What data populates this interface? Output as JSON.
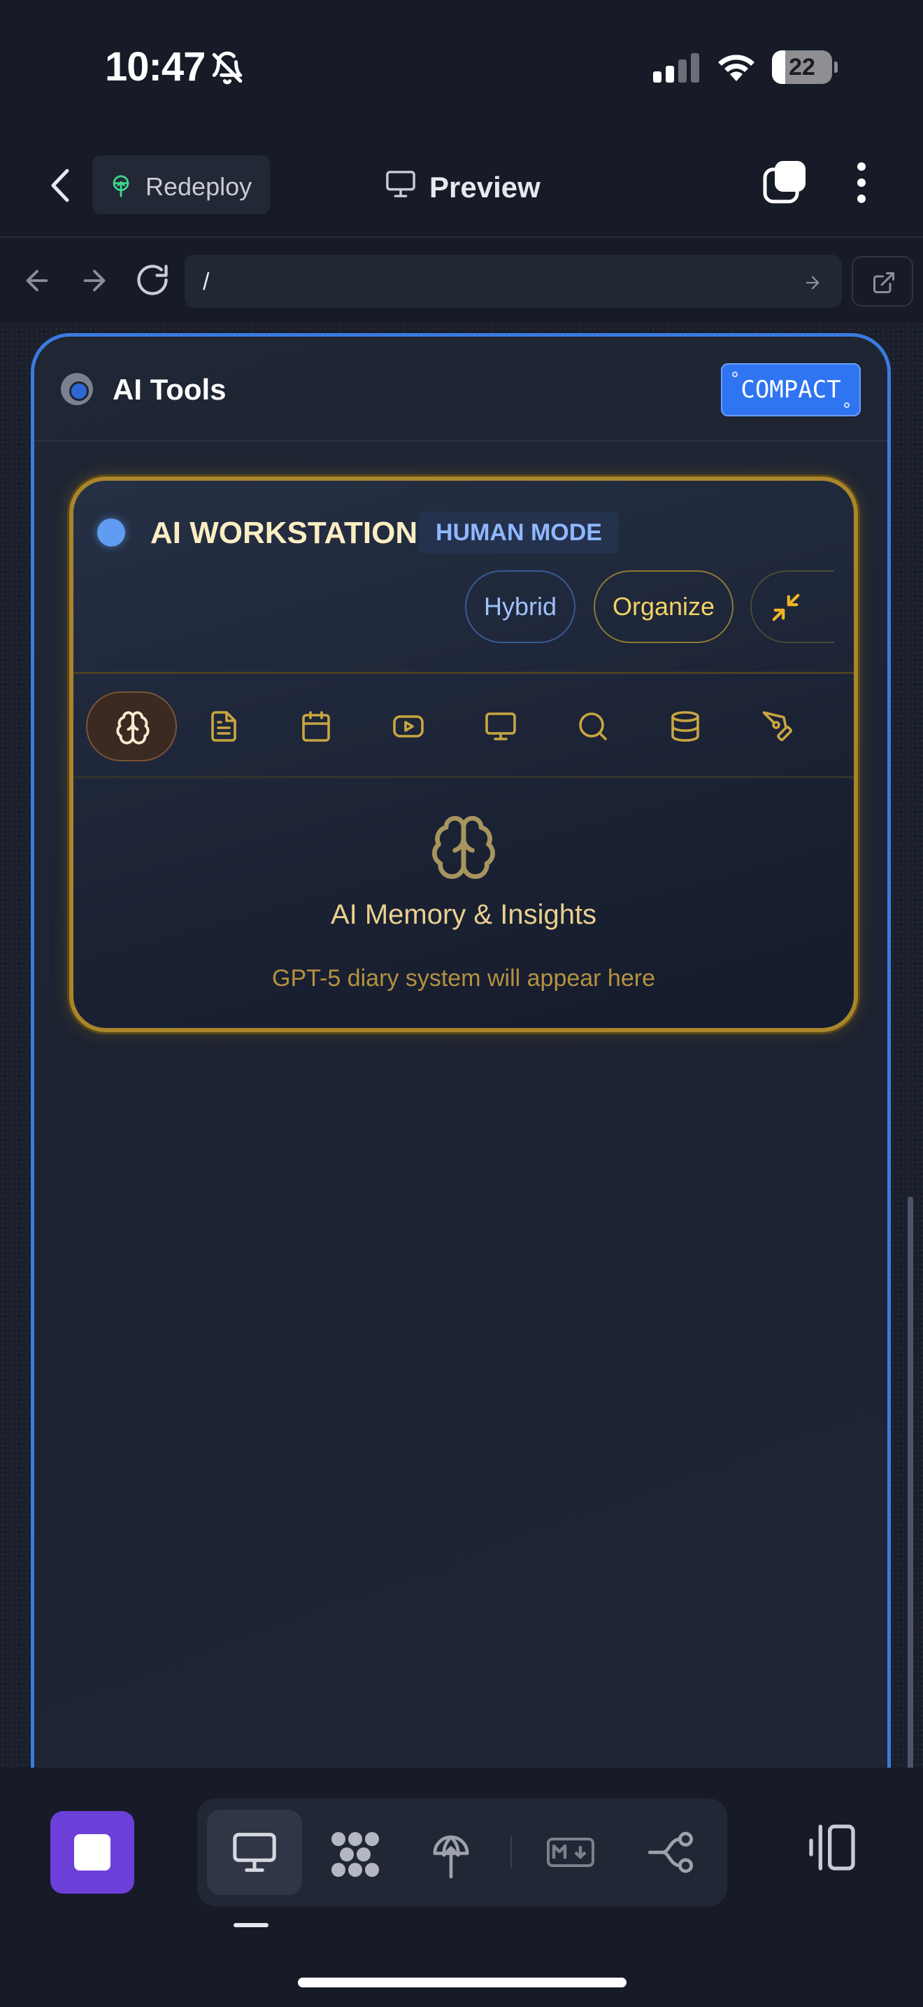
{
  "status_bar": {
    "time": "10:47",
    "battery_level": "22",
    "battery_fraction": 0.22,
    "icons": [
      "bell-slash-icon",
      "signal-icon",
      "wifi-icon",
      "battery-icon"
    ]
  },
  "header": {
    "redeploy_label": "Redeploy",
    "title": "Preview"
  },
  "url_bar": {
    "value": "/"
  },
  "panel": {
    "title": "AI Tools",
    "compact_label": "COMPACT"
  },
  "workstation": {
    "title": "AI WORKSTATION",
    "mode_badge": "HUMAN MODE",
    "pills": {
      "hybrid": "Hybrid",
      "organize": "Organize"
    },
    "tools": [
      "brain-icon",
      "document-icon",
      "calendar-icon",
      "video-icon",
      "monitor-icon",
      "search-icon",
      "database-icon",
      "pen-icon"
    ],
    "active_tool": "brain-icon",
    "body_title": "AI Memory & Insights",
    "body_subtitle": "GPT-5 diary system will appear here"
  },
  "bottom_bar": {
    "dock_icons": [
      "monitor-icon",
      "dots-grid-icon",
      "deploy-tree-icon",
      "markdown-icon",
      "branch-icon"
    ],
    "active_dock": "monitor-icon"
  },
  "colors": {
    "accent_blue": "#3b7be0",
    "gold_border": "#a9852b",
    "stop_purple": "#6d3fd9",
    "background": "#161b27"
  }
}
